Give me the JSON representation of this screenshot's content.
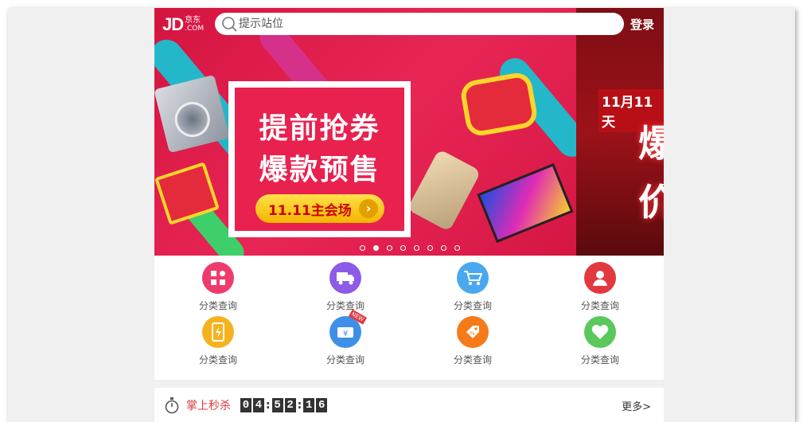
{
  "header": {
    "logo_main": "JD",
    "logo_cn": "京东",
    "logo_com": ".COM",
    "search_placeholder": "提示站位",
    "login_label": "登录"
  },
  "banner": {
    "promo_line1": "提前抢券",
    "promo_line2": "爆款预售",
    "promo_button": "11.11主会场",
    "right_title": "11月11天",
    "right_big1": "爆",
    "right_big2": "价",
    "dots_count": 8,
    "active_dot": 1
  },
  "categories": [
    {
      "label": "分类查询",
      "icon": "grid-icon",
      "color": "#ee3b6e"
    },
    {
      "label": "分类查询",
      "icon": "truck-icon",
      "color": "#8e5ae8"
    },
    {
      "label": "分类查询",
      "icon": "cart-icon",
      "color": "#4aa8f0"
    },
    {
      "label": "分类查询",
      "icon": "user-icon",
      "color": "#e2383f"
    },
    {
      "label": "分类查询",
      "icon": "phone-charge-icon",
      "color": "#f6b21d"
    },
    {
      "label": "分类查询",
      "icon": "ticket-new-icon",
      "color": "#3f8fe8"
    },
    {
      "label": "分类查询",
      "icon": "discount-tag-icon",
      "color": "#f57a1a"
    },
    {
      "label": "分类查询",
      "icon": "heart-icon",
      "color": "#5ac85a"
    }
  ],
  "flash_sale": {
    "title": "掌上秒杀",
    "countdown": [
      "0",
      "4",
      "5",
      "2",
      "1",
      "6"
    ],
    "more_label": "更多>"
  }
}
